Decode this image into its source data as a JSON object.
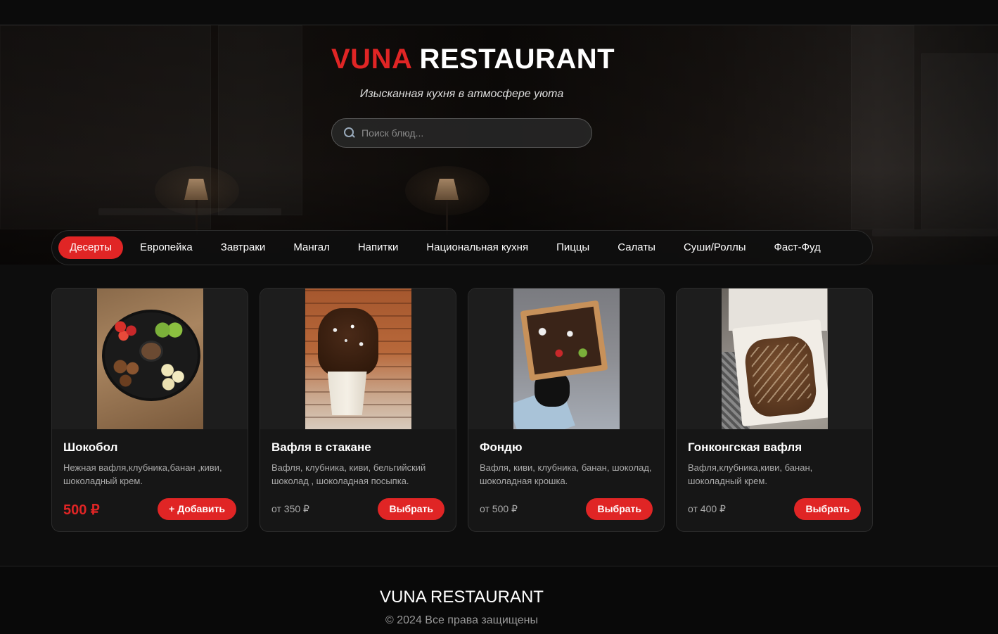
{
  "header": {
    "brand_accent": "VUNA",
    "brand_rest": "RESTAURANT",
    "tagline": "Изысканная кухня в атмосфере уюта"
  },
  "search": {
    "placeholder": "Поиск блюд...",
    "value": "",
    "icon": "search-icon"
  },
  "categories": [
    {
      "label": "Десерты",
      "active": true
    },
    {
      "label": "Европейка",
      "active": false
    },
    {
      "label": "Завтраки",
      "active": false
    },
    {
      "label": "Мангал",
      "active": false
    },
    {
      "label": "Напитки",
      "active": false
    },
    {
      "label": "Национальная кухня",
      "active": false
    },
    {
      "label": "Пиццы",
      "active": false
    },
    {
      "label": "Салаты",
      "active": false
    },
    {
      "label": "Суши/Роллы",
      "active": false
    },
    {
      "label": "Фаст-Фуд",
      "active": false
    }
  ],
  "products": [
    {
      "name": "Шокобол",
      "description": "Нежная вафля,клубника,банан ,киви, шоколадный крем.",
      "price": "500 ₽",
      "button": "+ Добавить"
    },
    {
      "name": "Вафля в стакане",
      "description": "Вафля, клубника, киви, бельгийский шоколад , шоколадная посыпка.",
      "price": "от 350 ₽",
      "button": "Выбрать"
    },
    {
      "name": "Фондю",
      "description": "Вафля, киви, клубника, банан, шоколад, шоколадная крошка.",
      "price": "от 500 ₽",
      "button": "Выбрать"
    },
    {
      "name": "Гонконгская вафля",
      "description": "Вафля,клубника,киви, банан, шоколадный крем.",
      "price": "от 400 ₽",
      "button": "Выбрать"
    }
  ],
  "footer": {
    "brand": "VUNA RESTAURANT",
    "copyright": "© 2024 Все права защищены"
  },
  "colors": {
    "accent": "#e02525",
    "background": "#0d0d0d",
    "card": "#161616"
  }
}
